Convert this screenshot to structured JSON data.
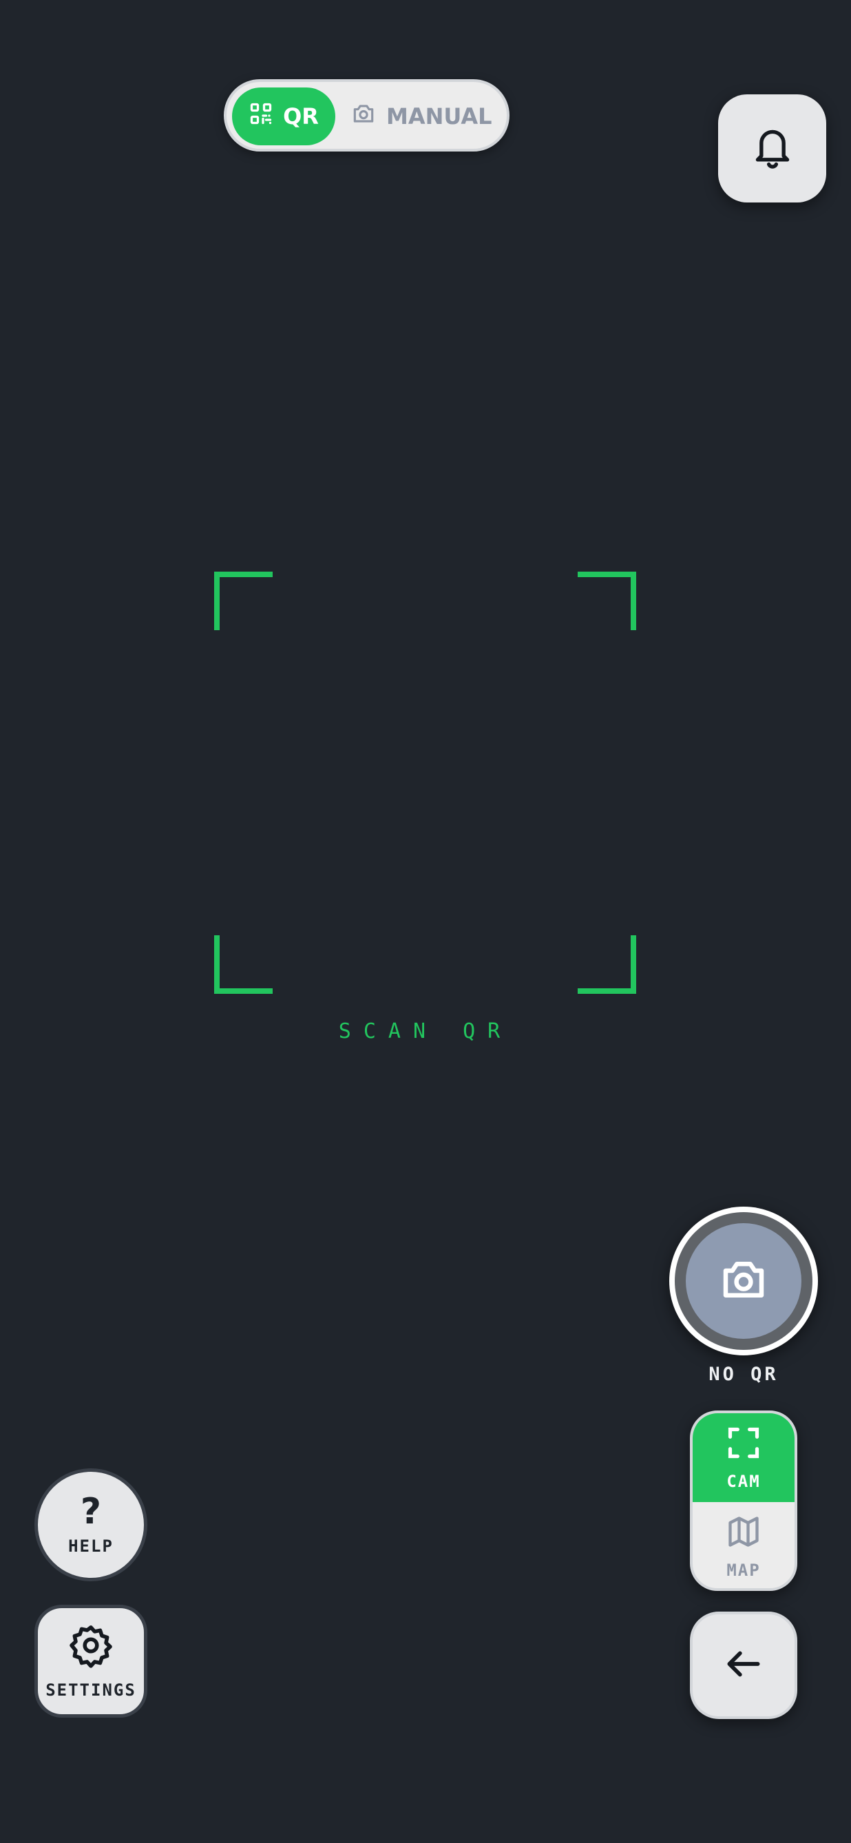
{
  "mode_toggle": {
    "qr_label": "QR",
    "manual_label": "MANUAL",
    "selected": "QR"
  },
  "scanner": {
    "label": "SCAN QR"
  },
  "shutter": {
    "label": "NO QR"
  },
  "view_switch": {
    "cam_label": "CAM",
    "map_label": "MAP",
    "selected": "CAM"
  },
  "help": {
    "icon_text": "?",
    "label": "HELP"
  },
  "settings": {
    "label": "SETTINGS"
  },
  "colors": {
    "accent": "#22c55e",
    "background": "#20252c",
    "button": "#e6e7e9",
    "muted": "#8e96a5"
  },
  "icons": [
    "qr-code-icon",
    "camera-icon",
    "bell-icon",
    "scan-frame-icon",
    "map-icon",
    "arrow-left-icon",
    "gear-icon"
  ]
}
